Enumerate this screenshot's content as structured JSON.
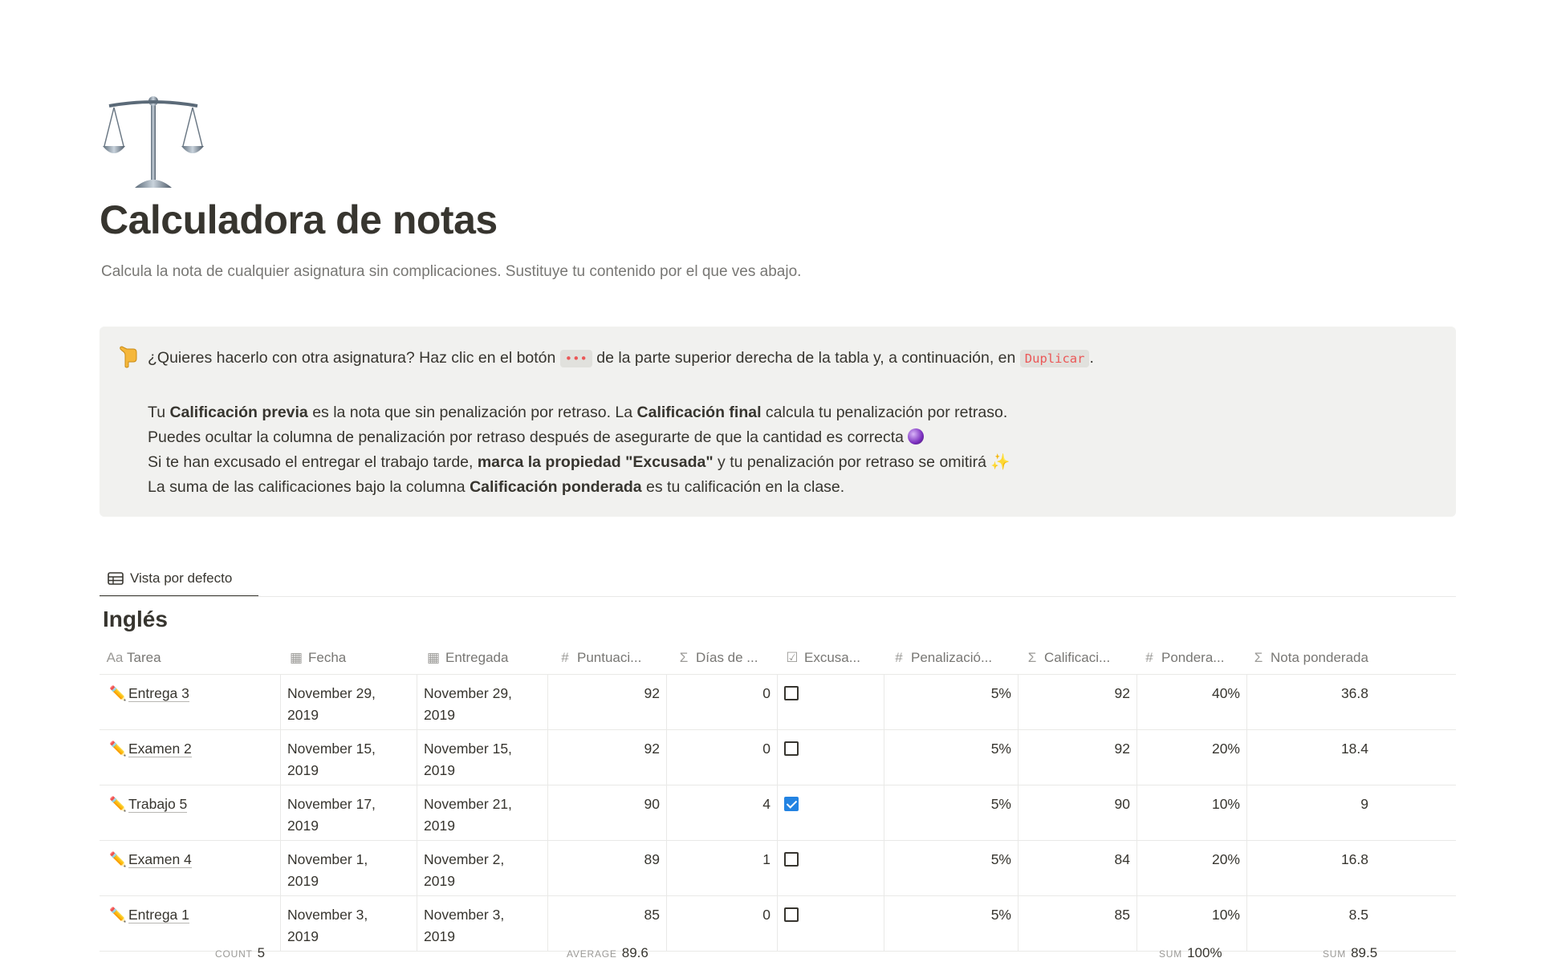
{
  "page": {
    "icon": "balance-scale-icon",
    "title": "Calculadora de notas",
    "description": "Calcula la nota de cualquier asignatura sin complicaciones. Sustituye tu contenido por el que ves abajo."
  },
  "callout": {
    "emoji": "pointing-down-hand-icon",
    "line1_a": "¿Quieres hacerlo con otra asignatura? Haz clic en el botón",
    "line1_code1": "•••",
    "line1_b": "de la parte superior derecha de la tabla y, a continuación, en",
    "line1_code2": "Duplicar",
    "line1_c": ".",
    "line2_a": "Tu ",
    "line2_b1": "Calificación previa",
    "line2_c": " es la nota que sin penalización por retraso. La ",
    "line2_b2": "Calificación final",
    "line2_d": " calcula tu penalización por retraso.",
    "line3": "Puedes ocultar la columna de penalización por retraso después de asegurarte de que la cantidad es correcta",
    "line4_a": "Si te han excusado el entregar el trabajo tarde, ",
    "line4_b": "marca la propiedad \"Excusada\"",
    "line4_c": " y tu penalización por retraso se omitirá",
    "line5_a": "La suma de las calificaciones bajo la columna ",
    "line5_b": "Calificación ponderada",
    "line5_c": " es tu calificación en la clase."
  },
  "view": {
    "tab_label": "Vista por defecto"
  },
  "group": {
    "title": "Inglés"
  },
  "columns": [
    {
      "icon": "Aa",
      "label": "Tarea"
    },
    {
      "icon": "calendar-icon",
      "label": "Fecha"
    },
    {
      "icon": "calendar-icon",
      "label": "Entregada"
    },
    {
      "icon": "#",
      "label": "Puntuaci..."
    },
    {
      "icon": "Σ",
      "label": "Días de ..."
    },
    {
      "icon": "checkbox-icon",
      "label": "Excusa..."
    },
    {
      "icon": "#",
      "label": "Penalizació..."
    },
    {
      "icon": "Σ",
      "label": "Calificaci..."
    },
    {
      "icon": "#",
      "label": "Pondera..."
    },
    {
      "icon": "Σ",
      "label": "Nota ponderada"
    }
  ],
  "rows": [
    {
      "tarea": "Entrega 3",
      "fecha_1": "November 29,",
      "fecha_2": "2019",
      "entregada_1": "November 29,",
      "entregada_2": "2019",
      "puntuacion": "92",
      "dias": "0",
      "excusada": false,
      "penalizacion": "5%",
      "calificacion": "92",
      "ponderacion": "40%",
      "nota": "36.8"
    },
    {
      "tarea": "Examen 2",
      "fecha_1": "November 15,",
      "fecha_2": "2019",
      "entregada_1": "November 15,",
      "entregada_2": "2019",
      "puntuacion": "92",
      "dias": "0",
      "excusada": false,
      "penalizacion": "5%",
      "calificacion": "92",
      "ponderacion": "20%",
      "nota": "18.4"
    },
    {
      "tarea": "Trabajo 5",
      "fecha_1": "November 17,",
      "fecha_2": "2019",
      "entregada_1": "November 21,",
      "entregada_2": "2019",
      "puntuacion": "90",
      "dias": "4",
      "excusada": true,
      "penalizacion": "5%",
      "calificacion": "90",
      "ponderacion": "10%",
      "nota": "9"
    },
    {
      "tarea": "Examen 4",
      "fecha_1": "November 1,",
      "fecha_2": "2019",
      "entregada_1": "November 2,",
      "entregada_2": "2019",
      "puntuacion": "89",
      "dias": "1",
      "excusada": false,
      "penalizacion": "5%",
      "calificacion": "84",
      "ponderacion": "20%",
      "nota": "16.8"
    },
    {
      "tarea": "Entrega 1",
      "fecha_1": "November 3,",
      "fecha_2": "2019",
      "entregada_1": "November 3,",
      "entregada_2": "2019",
      "puntuacion": "85",
      "dias": "0",
      "excusada": false,
      "penalizacion": "5%",
      "calificacion": "85",
      "ponderacion": "10%",
      "nota": "8.5"
    }
  ],
  "footer": {
    "count_label": "COUNT",
    "count_value": "5",
    "average_label": "AVERAGE",
    "average_value": "89.6",
    "sum1_label": "SUM",
    "sum1_value": "100%",
    "sum2_label": "SUM",
    "sum2_value": "89.5"
  },
  "colors": {
    "text": "#37352f",
    "muted": "#787774",
    "callout_bg": "#f1f1ef",
    "checkbox_checked": "#2383e2",
    "code": "#eb5757"
  }
}
